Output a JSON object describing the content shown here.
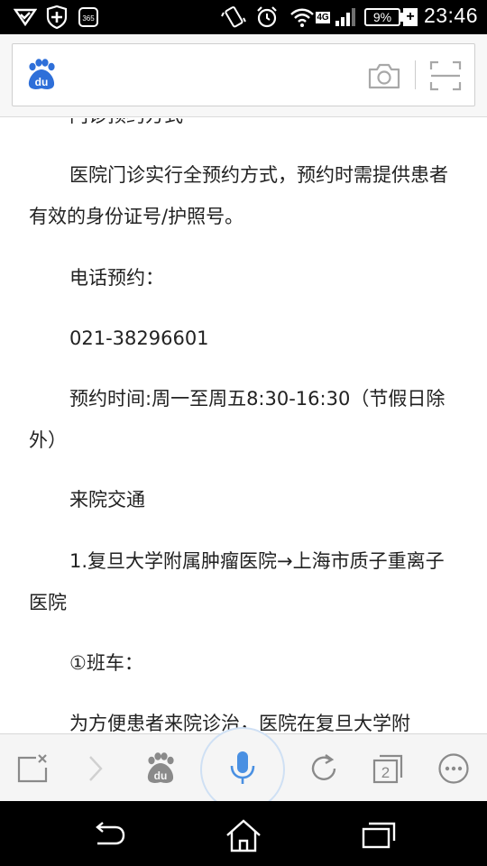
{
  "status_bar": {
    "time": "23:46",
    "battery": "9%",
    "network": "4G",
    "icons": [
      "signal-check-icon",
      "shield-plus-icon",
      "app-365-icon",
      "vibrate-icon",
      "alarm-icon",
      "wifi-icon",
      "network-4g-icon",
      "cell-signal-icon",
      "battery-icon",
      "charging-icon"
    ]
  },
  "search_bar": {
    "logo": "baidu-du-logo",
    "logo_text": "du",
    "icons": [
      "camera-icon",
      "scan-icon"
    ]
  },
  "article": {
    "cut_heading": "门诊预约方式",
    "paragraphs": [
      "医院门诊实行全预约方式，预约时需提供患者有效的身份证号/护照号。",
      "电话预约：",
      "021-38296601",
      "预约时间:周一至周五8:30-16:30（节假日除外）",
      "来院交通",
      "1.复旦大学附属肿瘤医院→上海市质子重离子医院",
      "①班车：",
      "为方便患者来院诊治，医院在复旦大学附"
    ]
  },
  "toolbar": {
    "tab_count": "2",
    "icons": [
      "close-page-icon",
      "forward-icon",
      "baidu-home-icon",
      "microphone-icon",
      "refresh-icon",
      "tabs-icon",
      "more-icon"
    ]
  },
  "nav_bar": {
    "icons": [
      "back-icon",
      "home-icon",
      "recent-apps-icon"
    ]
  },
  "colors": {
    "accent_blue": "#2e6fd9",
    "voice_blue": "#4a90e2",
    "text": "#222222",
    "icon_gray": "#8a8a8a"
  }
}
